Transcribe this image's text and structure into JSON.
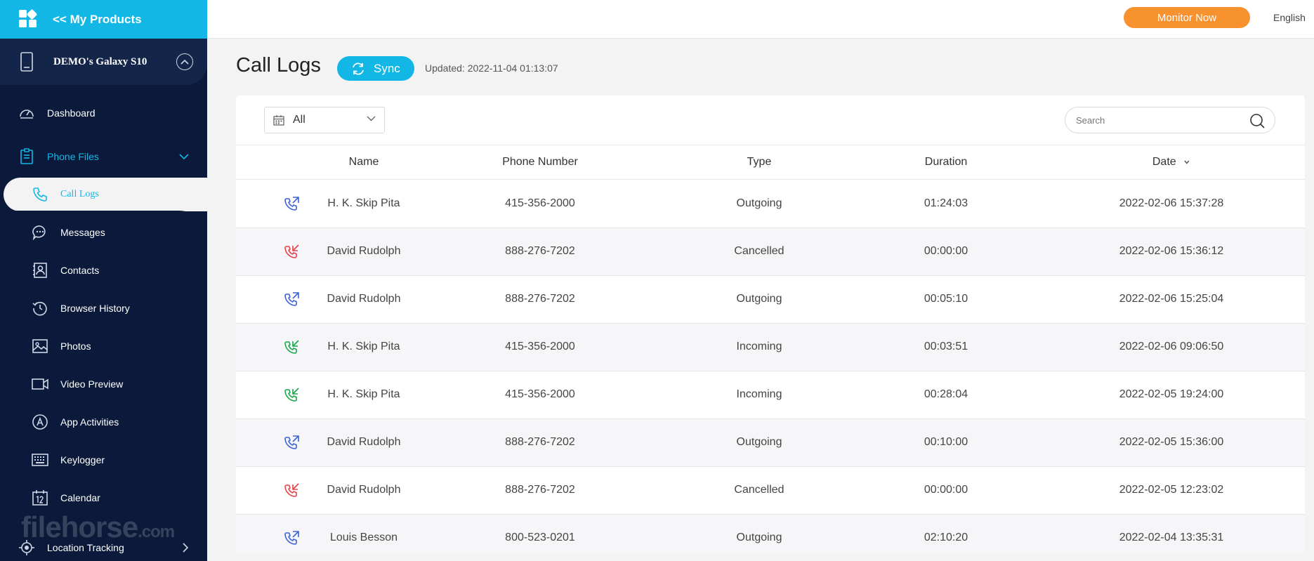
{
  "brand": {
    "title": "<< My Products"
  },
  "device": {
    "name": "DEMO's Galaxy S10"
  },
  "nav": {
    "dashboard": "Dashboard",
    "phone_files": "Phone Files",
    "call_logs": "Call Logs",
    "messages": "Messages",
    "contacts": "Contacts",
    "browser_history": "Browser History",
    "photos": "Photos",
    "video_preview": "Video Preview",
    "app_activities": "App Activities",
    "keylogger": "Keylogger",
    "calendar": "Calendar",
    "location_tracking": "Location Tracking"
  },
  "watermark": {
    "main": "filehorse",
    "suffix": ".com"
  },
  "topbar": {
    "monitor_label": "Monitor Now",
    "language": "English"
  },
  "header": {
    "title": "Call Logs",
    "sync_label": "Sync",
    "updated": "Updated: 2022-11-04 01:13:07"
  },
  "filter": {
    "value": "All"
  },
  "search": {
    "placeholder": "Search"
  },
  "table": {
    "columns": {
      "name": "Name",
      "phone": "Phone Number",
      "type": "Type",
      "duration": "Duration",
      "date": "Date"
    },
    "rows": [
      {
        "name": "H. K. Skip Pita",
        "phone": "415-356-2000",
        "type": "Outgoing",
        "duration": "01:24:03",
        "date": "2022-02-06 15:37:28"
      },
      {
        "name": "David Rudolph",
        "phone": "888-276-7202",
        "type": "Cancelled",
        "duration": "00:00:00",
        "date": "2022-02-06 15:36:12"
      },
      {
        "name": "David Rudolph",
        "phone": "888-276-7202",
        "type": "Outgoing",
        "duration": "00:05:10",
        "date": "2022-02-06 15:25:04"
      },
      {
        "name": "H. K. Skip Pita",
        "phone": "415-356-2000",
        "type": "Incoming",
        "duration": "00:03:51",
        "date": "2022-02-06 09:06:50"
      },
      {
        "name": "H. K. Skip Pita",
        "phone": "415-356-2000",
        "type": "Incoming",
        "duration": "00:28:04",
        "date": "2022-02-05 19:24:00"
      },
      {
        "name": "David Rudolph",
        "phone": "888-276-7202",
        "type": "Outgoing",
        "duration": "00:10:00",
        "date": "2022-02-05 15:36:00"
      },
      {
        "name": "David Rudolph",
        "phone": "888-276-7202",
        "type": "Cancelled",
        "duration": "00:00:00",
        "date": "2022-02-05 12:23:02"
      },
      {
        "name": "Louis Besson",
        "phone": "800-523-0201",
        "type": "Outgoing",
        "duration": "02:10:20",
        "date": "2022-02-04 13:35:31"
      }
    ]
  },
  "icons": {
    "outgoing": "outgoing-call-icon",
    "incoming": "incoming-call-icon",
    "cancelled": "cancelled-call-icon"
  },
  "colors": {
    "accent": "#12b7e6",
    "sidebar": "#0b1a3a",
    "monitor": "#f7922e",
    "outgoing": "#3a62d9",
    "incoming": "#17a84a",
    "cancelled": "#e8404a"
  }
}
